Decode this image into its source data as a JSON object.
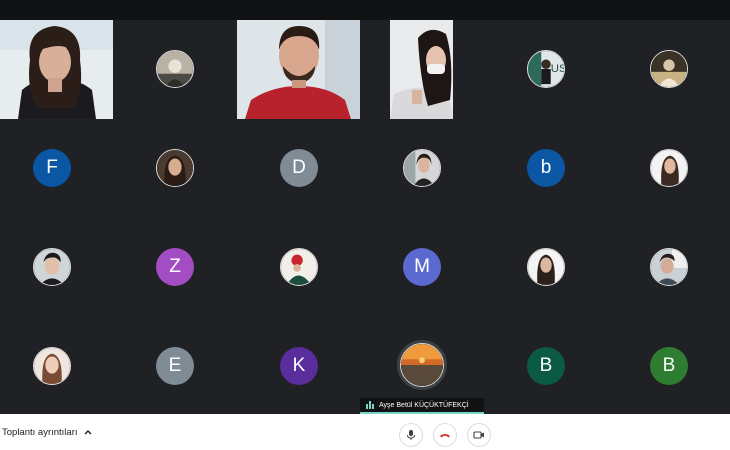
{
  "meeting": {
    "details_label": "Toplantı ayrıntıları",
    "active_speaker": "Ayşe Betül KÜÇÜKTÜFEKÇİ"
  },
  "participants": [
    {
      "type": "video"
    },
    {
      "type": "photo"
    },
    {
      "type": "video"
    },
    {
      "type": "video"
    },
    {
      "type": "photo"
    },
    {
      "type": "photo"
    },
    {
      "type": "initial",
      "initial": "F",
      "color": "#0b57a4"
    },
    {
      "type": "photo"
    },
    {
      "type": "initial",
      "initial": "D",
      "color": "#7f8c96"
    },
    {
      "type": "photo"
    },
    {
      "type": "initial",
      "initial": "b",
      "color": "#0b57a4"
    },
    {
      "type": "photo"
    },
    {
      "type": "photo"
    },
    {
      "type": "initial",
      "initial": "Z",
      "color": "#a34dc4"
    },
    {
      "type": "photo"
    },
    {
      "type": "initial",
      "initial": "M",
      "color": "#5b6ad0"
    },
    {
      "type": "photo"
    },
    {
      "type": "photo"
    },
    {
      "type": "photo"
    },
    {
      "type": "initial",
      "initial": "E",
      "color": "#7f8c96"
    },
    {
      "type": "initial",
      "initial": "K",
      "color": "#5a2d9c"
    },
    {
      "type": "photo"
    },
    {
      "type": "initial",
      "initial": "B",
      "color": "#0b5a46"
    },
    {
      "type": "initial",
      "initial": "B",
      "color": "#2e7d32"
    }
  ],
  "colors": {
    "accent": "#7ad3c7",
    "end_call": "#d93025",
    "background": "#202124"
  },
  "icons": {
    "mic": "microphone-icon",
    "end": "end-call-icon",
    "camera": "camera-icon",
    "details": "chevron-up-icon"
  }
}
